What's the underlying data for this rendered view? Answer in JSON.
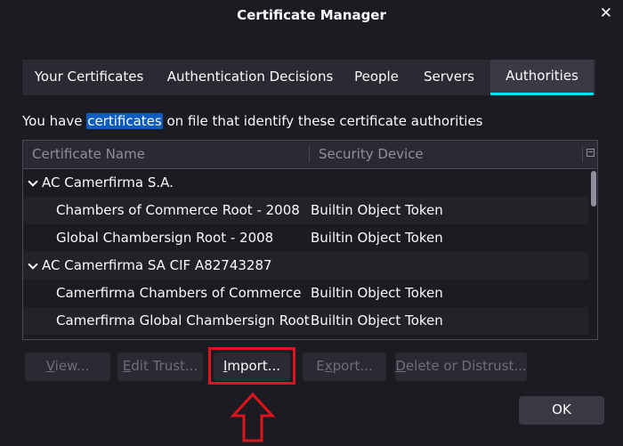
{
  "window": {
    "title": "Certificate Manager",
    "close_glyph": "✕"
  },
  "tabs": [
    {
      "label": "Your Certificates"
    },
    {
      "label": "Authentication Decisions"
    },
    {
      "label": "People"
    },
    {
      "label": "Servers"
    },
    {
      "label": "Authorities",
      "active": true
    }
  ],
  "description": {
    "before": "You have ",
    "highlight": "certificates",
    "after": " on file that identify these certificate authorities"
  },
  "tree": {
    "columns": [
      "Certificate Name",
      "Security Device"
    ],
    "rows": [
      {
        "name": "AC Camerfirma S.A.",
        "device": "",
        "group": true
      },
      {
        "name": "Chambers of Commerce Root - 2008",
        "device": "Builtin Object Token"
      },
      {
        "name": "Global Chambersign Root - 2008",
        "device": "Builtin Object Token"
      },
      {
        "name": "AC Camerfirma SA CIF A82743287",
        "device": "",
        "group": true
      },
      {
        "name": "Camerfirma Chambers of Commerce Ro...",
        "device": "Builtin Object Token"
      },
      {
        "name": "Camerfirma Global Chambersign Root",
        "device": "Builtin Object Token"
      }
    ]
  },
  "buttons": {
    "view": {
      "key": "V",
      "rest": "iew..."
    },
    "edit_trust": {
      "key": "E",
      "rest": "dit Trust..."
    },
    "import": {
      "key": "I",
      "rest": "mport..."
    },
    "export": {
      "key": "x",
      "pre": "E",
      "rest": "port..."
    },
    "delete": {
      "key": "D",
      "rest": "elete or Distrust..."
    },
    "ok": "OK"
  },
  "colors": {
    "accent": "#00ddff",
    "highlight": "#0b5cbf",
    "annotation": "#e0141e",
    "background": "#1c1b22"
  }
}
